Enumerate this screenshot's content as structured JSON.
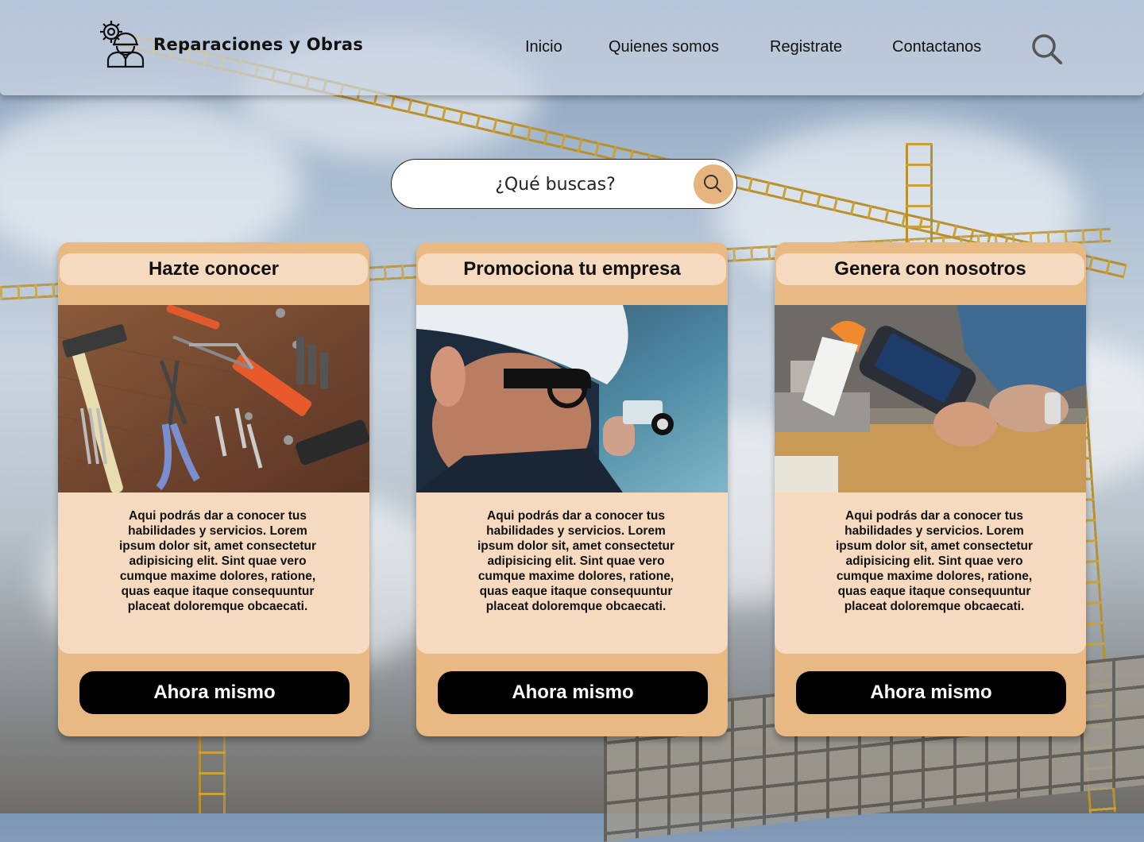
{
  "navbar": {
    "brand": "Reparaciones y Obras",
    "logo_icon": "worker-gear-icon",
    "links": [
      "Inicio",
      "Quienes somos",
      "Registrate",
      "Contactanos"
    ],
    "search_icon": "search-icon"
  },
  "search": {
    "placeholder": "¿Qué buscas?",
    "button_icon": "search-icon"
  },
  "cards": [
    {
      "title": "Hazte conocer",
      "image": "tools-on-wood-photo",
      "text": "Aqui podrás dar a conocer tus habilidades y servicios. Lorem ipsum dolor sit, amet consectetur adipisicing elit. Sint quae vero cumque maxime dolores, ratione, quas eaque itaque consequuntur placeat doloremque obcaecati.",
      "button": "Ahora mismo"
    },
    {
      "title": "Promociona tu empresa",
      "image": "electrician-at-work-photo",
      "text": "Aqui podrás dar a conocer tus habilidades y servicios. Lorem ipsum dolor sit, amet consectetur adipisicing elit. Sint quae vero cumque maxime dolores, ratione, quas eaque itaque consequuntur placeat doloremque obcaecati.",
      "button": "Ahora mismo"
    },
    {
      "title": "Genera con nosotros",
      "image": "payment-terminal-photo",
      "text": "Aqui podrás dar a conocer tus habilidades y servicios. Lorem ipsum dolor sit, amet consectetur adipisicing elit. Sint quae vero cumque maxime dolores, ratione, quas eaque itaque consequuntur placeat doloremque obcaecati.",
      "button": "Ahora mismo"
    }
  ],
  "colors": {
    "card_accent": "#e8b983",
    "card_light": "#f5dabf",
    "button_bg": "#000000",
    "search_button": "#e6b57f"
  }
}
